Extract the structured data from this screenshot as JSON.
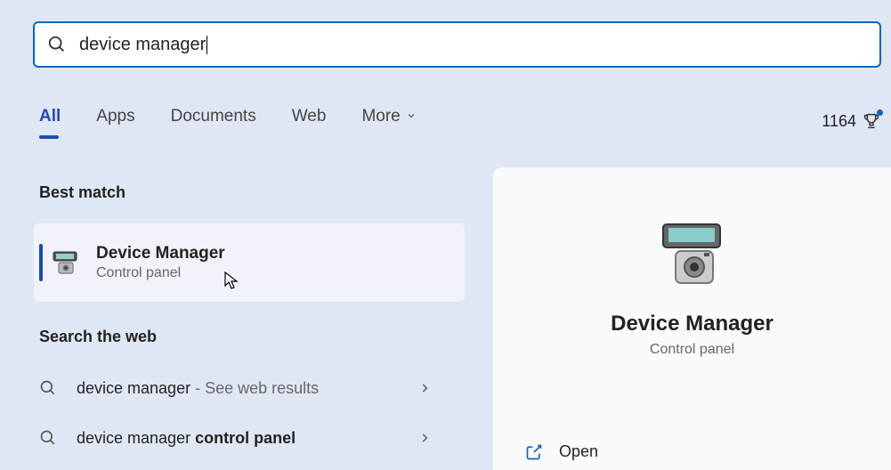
{
  "search": {
    "query": "device manager"
  },
  "tabs": {
    "all": "All",
    "apps": "Apps",
    "documents": "Documents",
    "web": "Web",
    "more": "More"
  },
  "points": "1164",
  "sections": {
    "best": "Best match",
    "web": "Search the web"
  },
  "best": {
    "title": "Device Manager",
    "subtitle": "Control panel"
  },
  "websuggest": [
    {
      "prefix": "device manager",
      "bold": "",
      "hint": " - See web results"
    },
    {
      "prefix": "device manager ",
      "bold": "control panel",
      "hint": ""
    }
  ],
  "detail": {
    "title": "Device Manager",
    "subtitle": "Control panel",
    "open": "Open"
  }
}
